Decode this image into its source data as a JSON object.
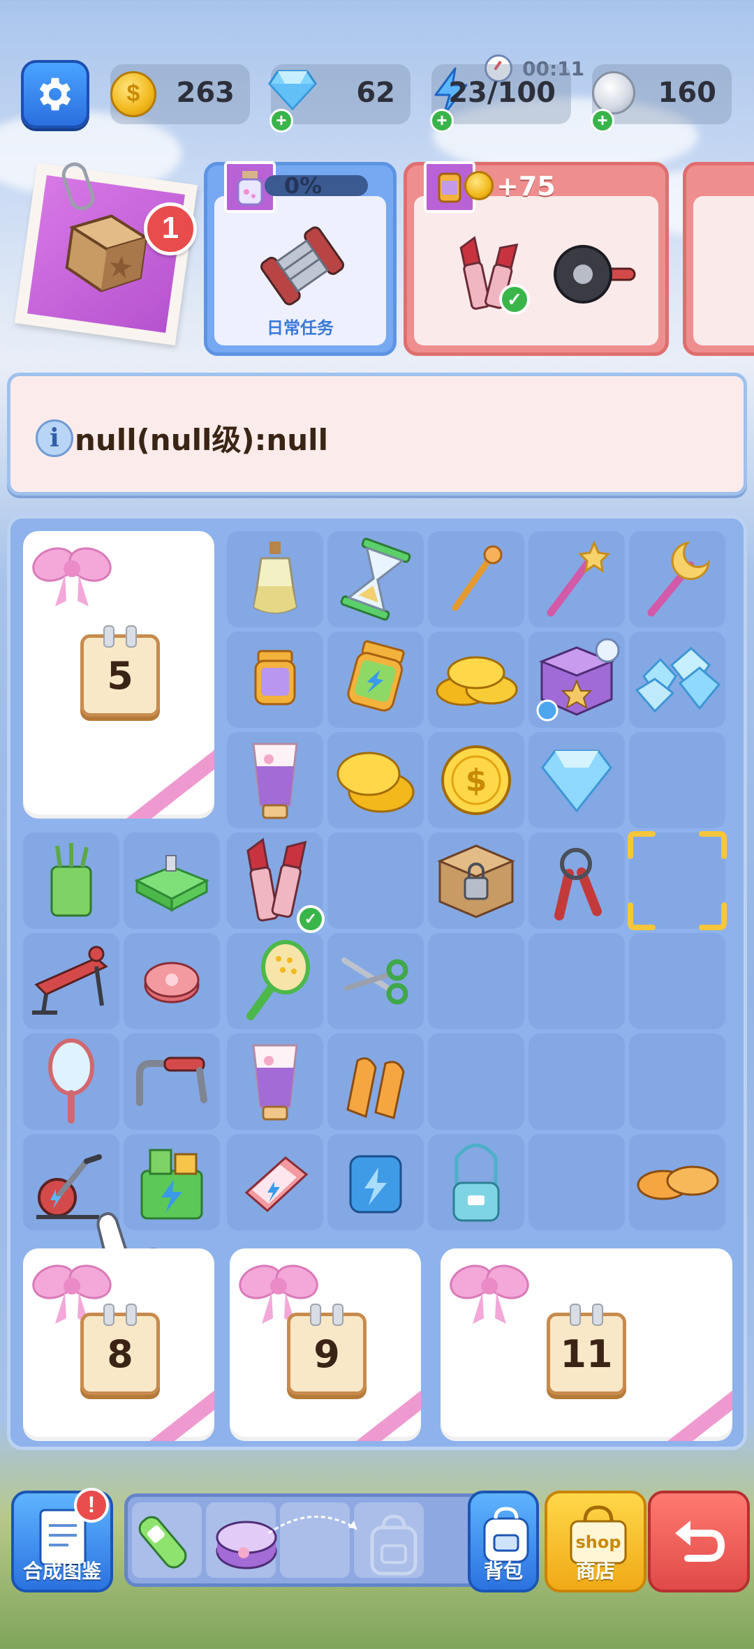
{
  "currencies": {
    "coins": "263",
    "gems": "62",
    "energy": "23/100",
    "energy_timer": "00:11",
    "silver": "160"
  },
  "orders": {
    "badge_count": "1",
    "daily_task": {
      "progress": "0%",
      "label": "日常任务"
    },
    "order2": {
      "reward": "+75"
    }
  },
  "info": {
    "text": "null(null级):null"
  },
  "board": {
    "gift_counts": [
      "5",
      "8",
      "9",
      "11"
    ]
  },
  "bottom": {
    "collection_label": "合成图鉴",
    "collection_alert": "!",
    "bag_label": "背包",
    "shop_label": "商店"
  },
  "colors": {
    "board": "#8eb2ec",
    "gift_ribbon": "#ee9ad0",
    "accent_blue": "#2b72e0",
    "accent_red": "#e04a48",
    "accent_yellow": "#f0a916"
  }
}
